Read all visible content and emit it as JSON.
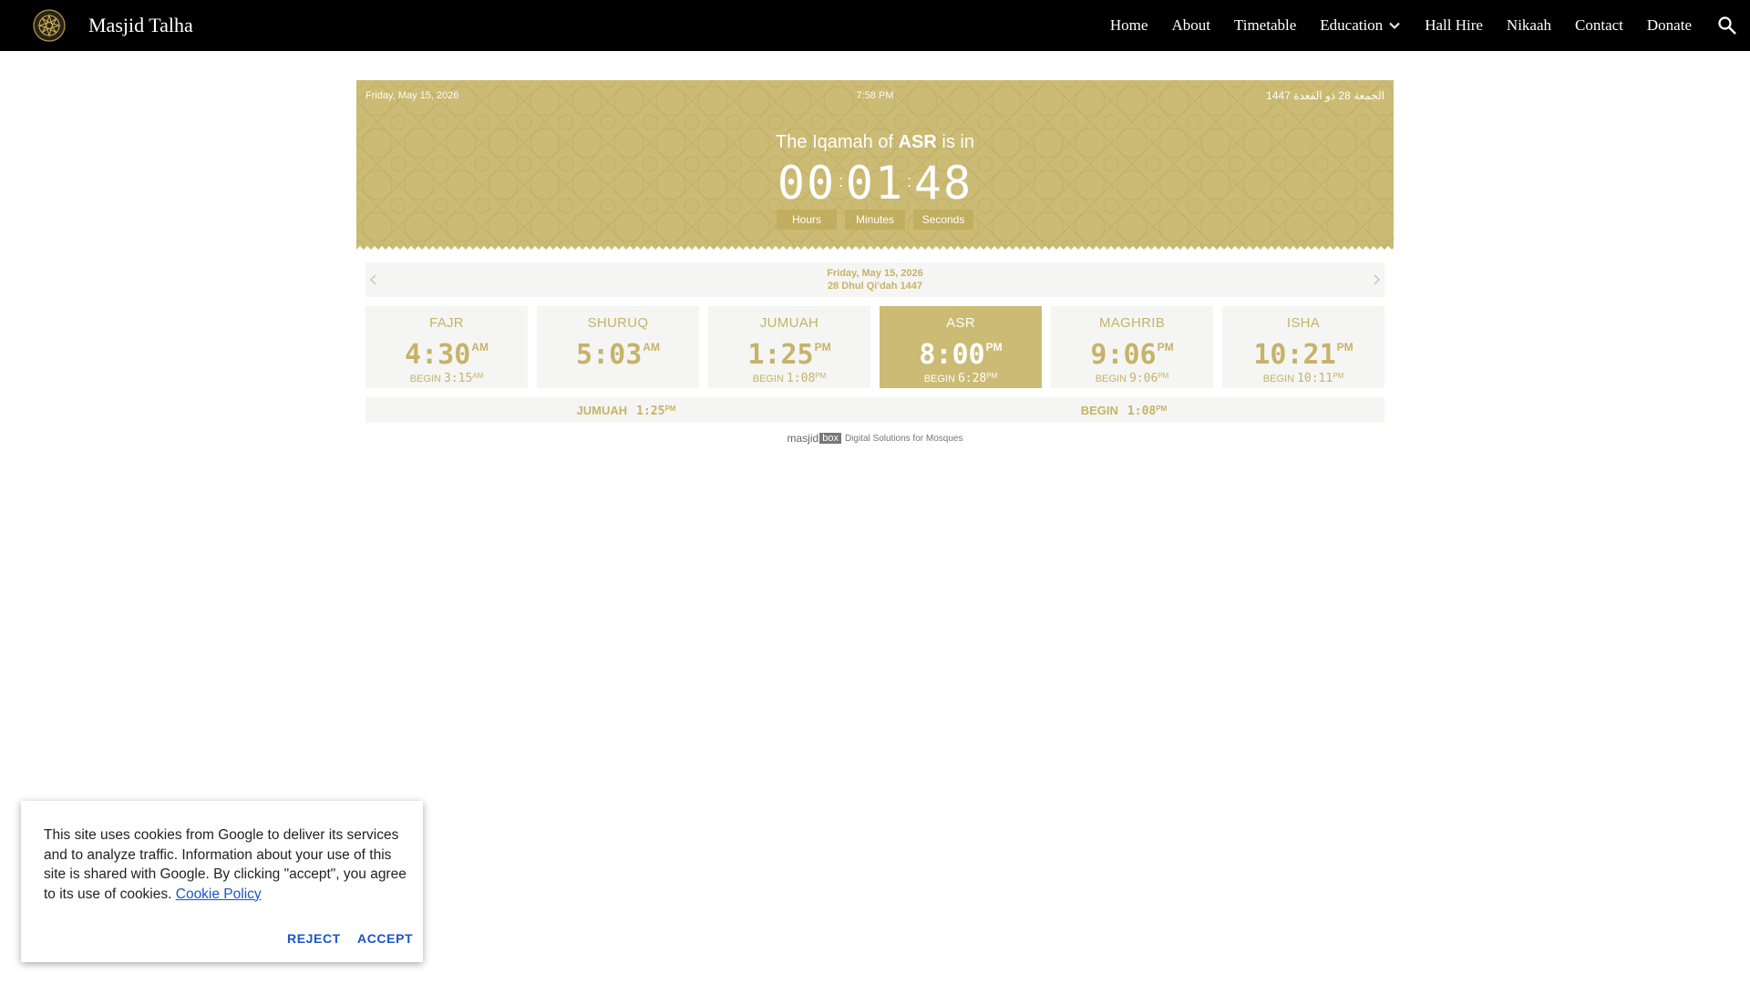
{
  "header": {
    "site_title": "Masjid Talha",
    "logo_icon": "mosque-star-logo-icon",
    "nav": [
      "Home",
      "About",
      "Timetable",
      "Education",
      "Hall Hire",
      "Nikaah",
      "Contact",
      "Donate"
    ],
    "search_icon": "search-icon"
  },
  "banner": {
    "date": "Friday, May 15, 2026",
    "time": "7:58 PM",
    "hijri": "الجمعة 28 ذو القعدة 1447",
    "iqamah_prefix": "The Iqamah of",
    "iqamah_prayer": "ASR",
    "iqamah_suffix": "is in",
    "countdown": {
      "hours": "00",
      "hours_label": "Hours",
      "minutes": "01",
      "minutes_label": "Minutes",
      "seconds": "48",
      "seconds_label": "Seconds"
    },
    "color": "#cbbb74"
  },
  "day_nav": {
    "gregorian": "Friday, May 15, 2026",
    "hijri": "28 Dhul Qi'dah 1447"
  },
  "prayers": [
    {
      "name": "FAJR",
      "time": "4:30",
      "ampm": "AM",
      "begin_label": "BEGIN",
      "begin": "3:15",
      "begin_ampm": "AM",
      "active": false
    },
    {
      "name": "SHURUQ",
      "time": "5:03",
      "ampm": "AM",
      "begin_label": "",
      "begin": "",
      "begin_ampm": "",
      "active": false
    },
    {
      "name": "JUMUAH",
      "time": "1:25",
      "ampm": "PM",
      "begin_label": "BEGIN",
      "begin": "1:08",
      "begin_ampm": "PM",
      "active": false
    },
    {
      "name": "ASR",
      "time": "8:00",
      "ampm": "PM",
      "begin_label": "BEGIN",
      "begin": "6:28",
      "begin_ampm": "PM",
      "active": true
    },
    {
      "name": "MAGHRIB",
      "time": "9:06",
      "ampm": "PM",
      "begin_label": "BEGIN",
      "begin": "9:06",
      "begin_ampm": "PM",
      "active": false
    },
    {
      "name": "ISHA",
      "time": "10:21",
      "ampm": "PM",
      "begin_label": "BEGIN",
      "begin": "10:11",
      "begin_ampm": "PM",
      "active": false
    }
  ],
  "jumuah_bar": {
    "left_label": "JUMUAH",
    "left_time": "1:25",
    "left_ampm": "PM",
    "right_label": "BEGIN",
    "right_time": "1:08",
    "right_ampm": "PM"
  },
  "branding": {
    "brand_part1": "masjid",
    "brand_part2": "box",
    "tagline": "Digital Solutions for Mosques"
  },
  "cookie": {
    "text": "This site uses cookies from Google to deliver its services and to analyze traffic. Information about your use of this site is shared with Google. By clicking \"accept\", you agree to its use of cookies.",
    "link": "Cookie Policy",
    "reject": "REJECT",
    "accept": "ACCEPT"
  },
  "colors": {
    "accent_gold": "#cbbb74",
    "text_gold": "#c6b36a",
    "link_blue": "#1a56c8"
  }
}
